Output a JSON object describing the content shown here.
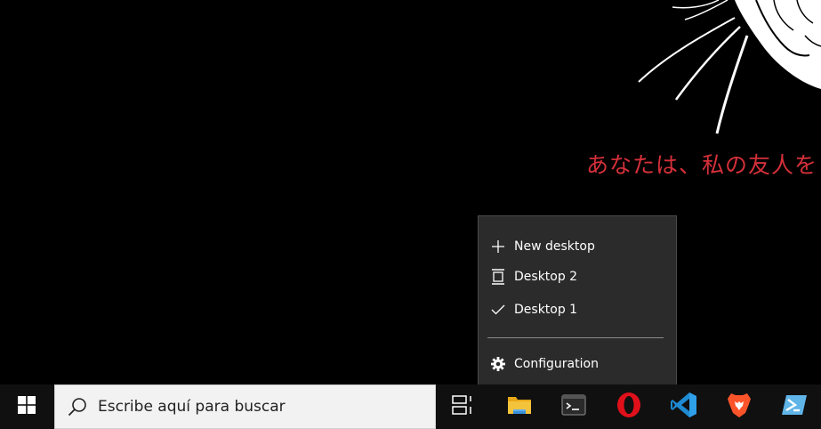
{
  "wallpaper": {
    "japanese_text": "あなたは、私の友人を",
    "text_color": "#d4303a"
  },
  "desktop_menu": {
    "items": [
      {
        "label": "New desktop",
        "icon": "plus-icon"
      },
      {
        "label": "Desktop 2",
        "icon": "desktop-icon"
      },
      {
        "label": "Desktop 1",
        "icon": "checkmark-icon",
        "current": true
      },
      {
        "label": "Configuration",
        "icon": "gear-icon"
      }
    ]
  },
  "taskbar": {
    "search_placeholder": "Escribe aquí para buscar",
    "apps": [
      {
        "name": "File Explorer",
        "icon": "folder-icon"
      },
      {
        "name": "Terminal",
        "icon": "terminal-icon"
      },
      {
        "name": "Opera",
        "icon": "opera-icon"
      },
      {
        "name": "Visual Studio Code",
        "icon": "vscode-icon"
      },
      {
        "name": "Brave",
        "icon": "brave-icon"
      },
      {
        "name": "PowerShell",
        "icon": "powershell-icon"
      }
    ],
    "colors": {
      "background": "#101010",
      "search_bg": "#f2f2f2",
      "opera": "#e0101b",
      "vscode": "#1f8ad2",
      "brave": "#fb542b",
      "folder": "#f4c33c"
    }
  }
}
